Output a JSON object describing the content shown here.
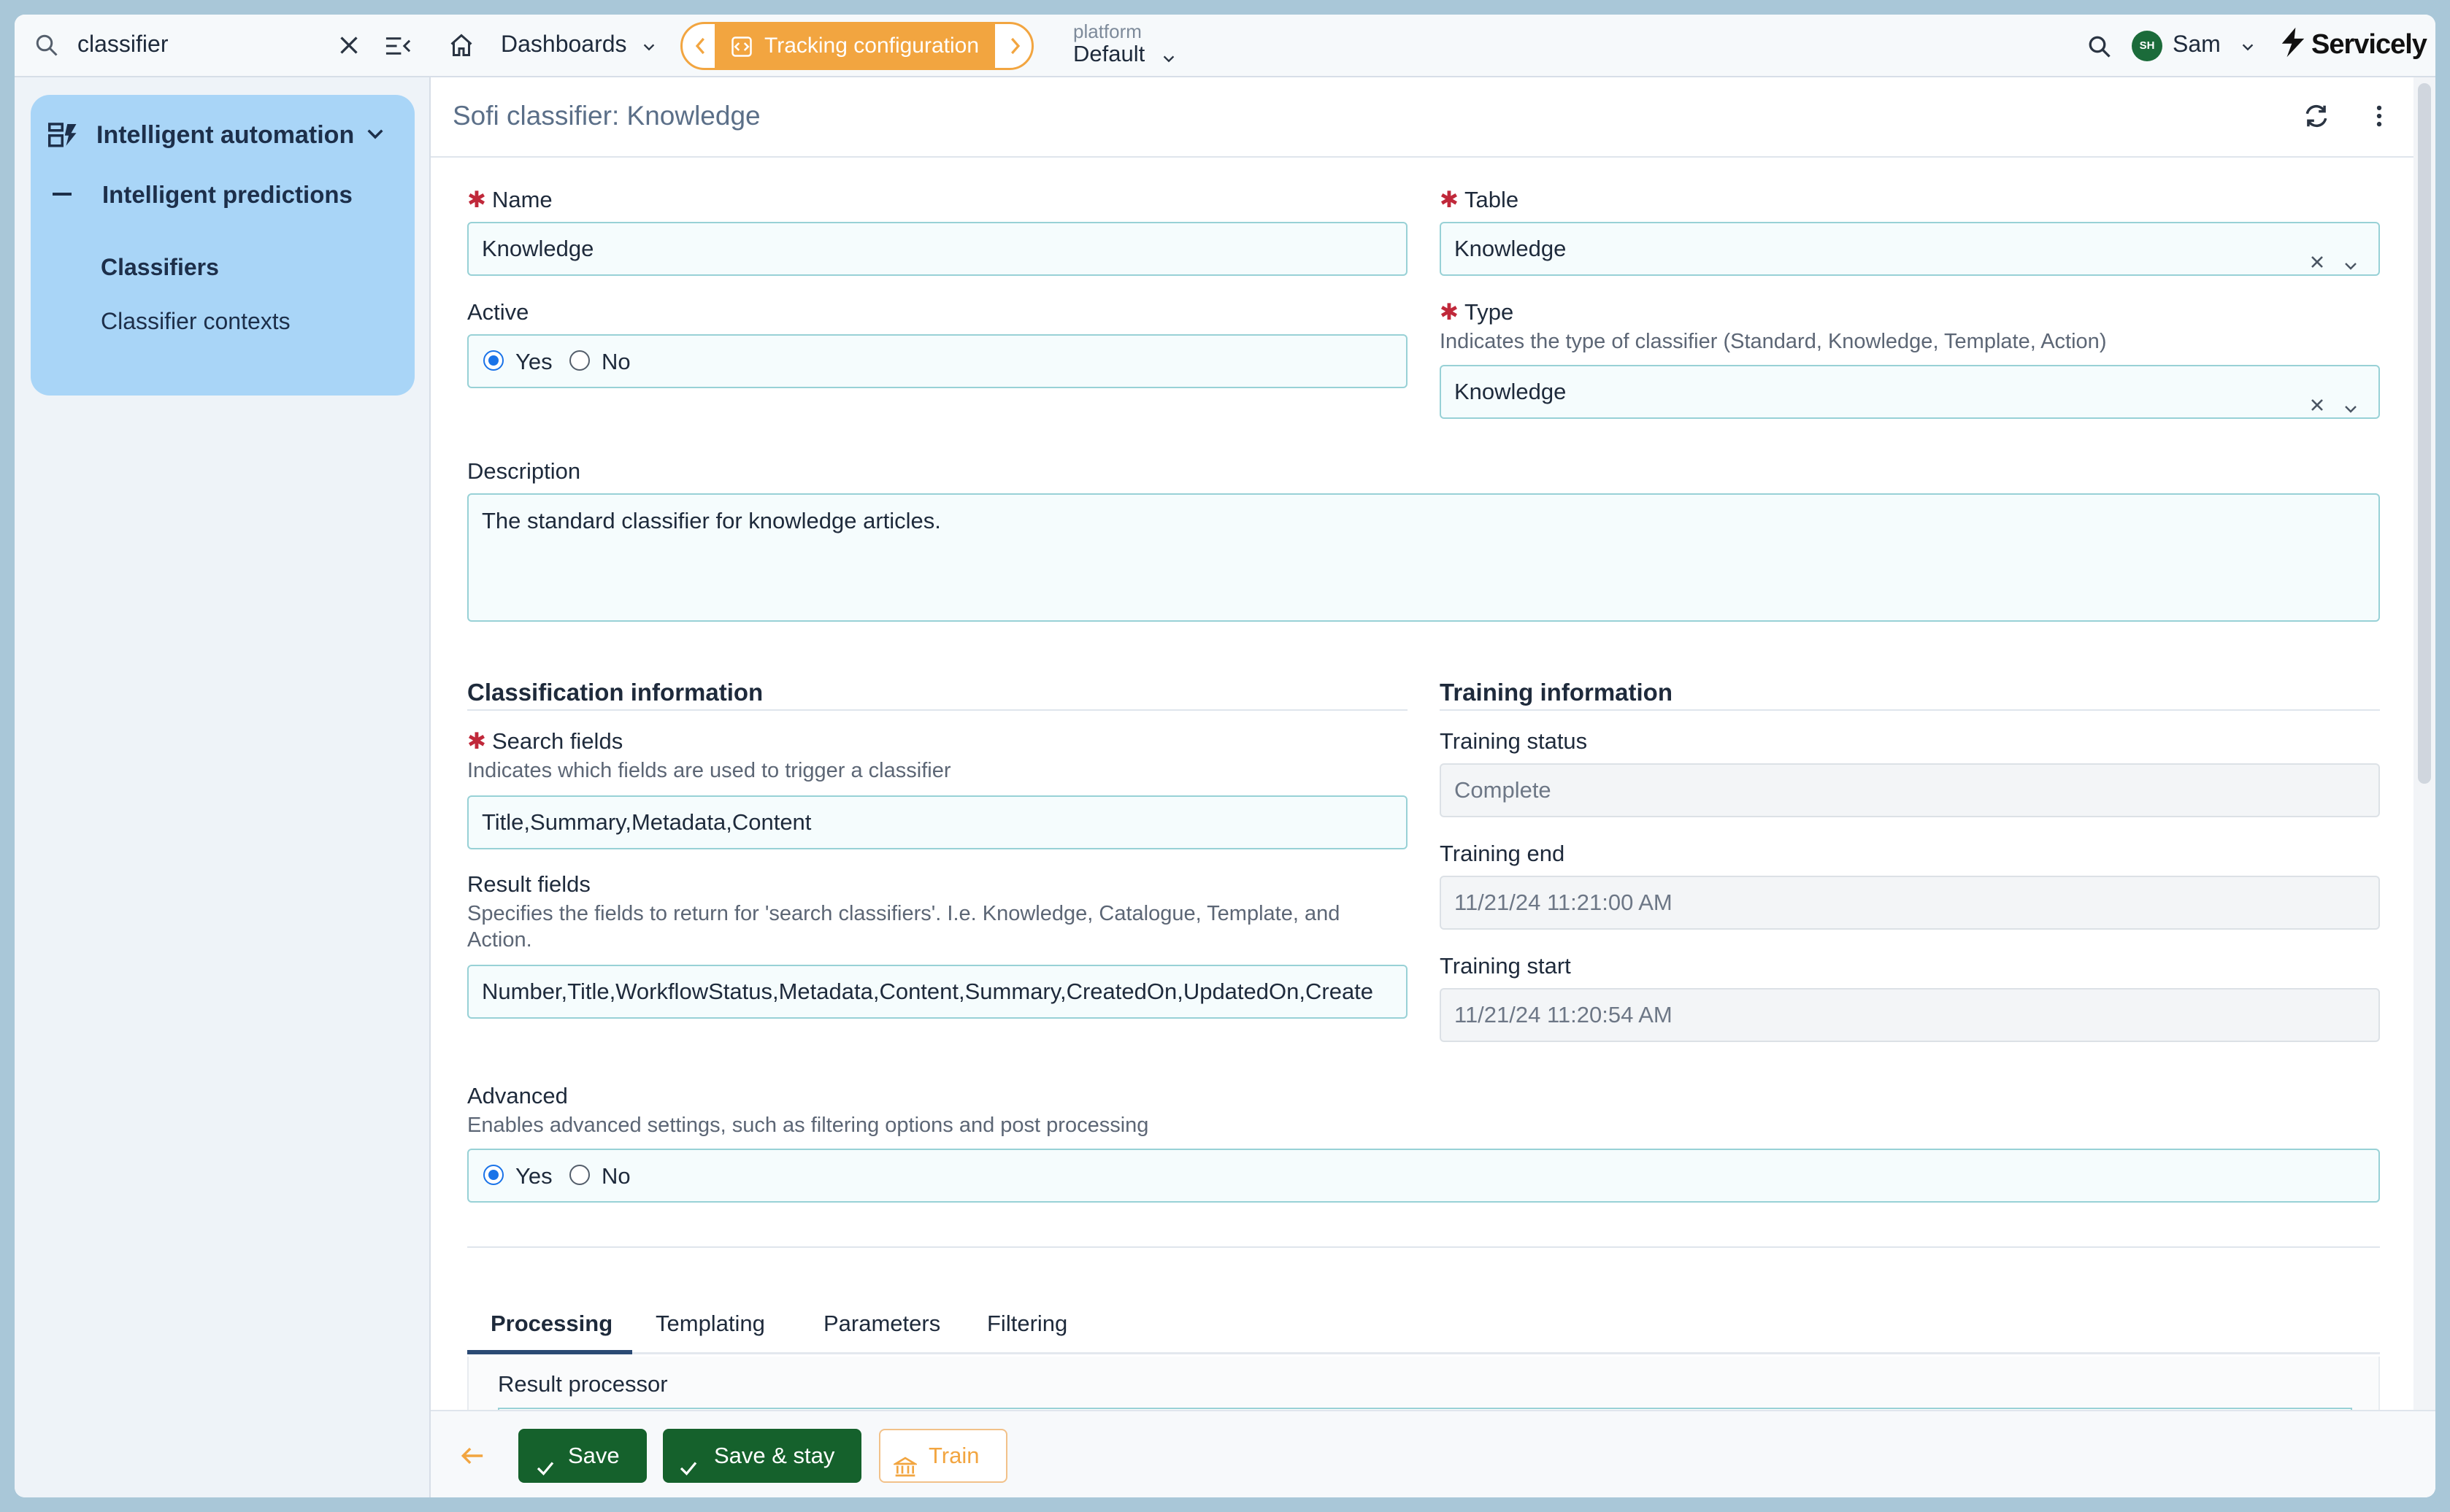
{
  "search": {
    "query": "classifier"
  },
  "sidebar": {
    "group_label": "Intelligent automation",
    "sub_label": "Intelligent predictions",
    "items": [
      {
        "label": "Classifiers",
        "active": true
      },
      {
        "label": "Classifier contexts",
        "active": false
      }
    ]
  },
  "topbar": {
    "dashboards_label": "Dashboards",
    "tracking_label": "Tracking configuration",
    "platform_label": "platform",
    "platform_value": "Default",
    "user_initials": "SH",
    "user_name": "Sam",
    "brand": "Servicely"
  },
  "page": {
    "title": "Sofi classifier: Knowledge"
  },
  "form": {
    "name": {
      "label": "Name",
      "value": "Knowledge"
    },
    "table": {
      "label": "Table",
      "value": "Knowledge"
    },
    "active": {
      "label": "Active",
      "yes": "Yes",
      "no": "No",
      "selected": "Yes"
    },
    "type": {
      "label": "Type",
      "hint": "Indicates the type of classifier (Standard, Knowledge, Template, Action)",
      "value": "Knowledge"
    },
    "description": {
      "label": "Description",
      "value": "The standard classifier for knowledge articles."
    },
    "classification": {
      "heading": "Classification information",
      "search_fields": {
        "label": "Search fields",
        "hint": "Indicates which fields are used to trigger a classifier",
        "value": "Title,Summary,Metadata,Content"
      },
      "result_fields": {
        "label": "Result fields",
        "hint": "Specifies the fields to return for 'search classifiers'. I.e. Knowledge, Catalogue, Template, and Action.",
        "value": "Number,Title,WorkflowStatus,Metadata,Content,Summary,CreatedOn,UpdatedOn,Create"
      }
    },
    "training": {
      "heading": "Training information",
      "status": {
        "label": "Training status",
        "value": "Complete"
      },
      "end": {
        "label": "Training end",
        "value": "11/21/24 11:21:00 AM"
      },
      "start": {
        "label": "Training start",
        "value": "11/21/24 11:20:54 AM"
      }
    },
    "advanced": {
      "label": "Advanced",
      "hint": "Enables advanced settings, such as filtering options and post processing",
      "yes": "Yes",
      "no": "No",
      "selected": "Yes"
    }
  },
  "tabs": [
    {
      "label": "Processing",
      "active": true
    },
    {
      "label": "Templating",
      "active": false
    },
    {
      "label": "Parameters",
      "active": false
    },
    {
      "label": "Filtering",
      "active": false
    }
  ],
  "tab_content": {
    "result_processor_label": "Result processor"
  },
  "footer": {
    "save": "Save",
    "save_stay": "Save & stay",
    "train": "Train"
  },
  "colors": {
    "accent": "#f2a540",
    "primary_button": "#15612c",
    "nav_card": "#a9d5f7",
    "required": "#c0283a"
  }
}
